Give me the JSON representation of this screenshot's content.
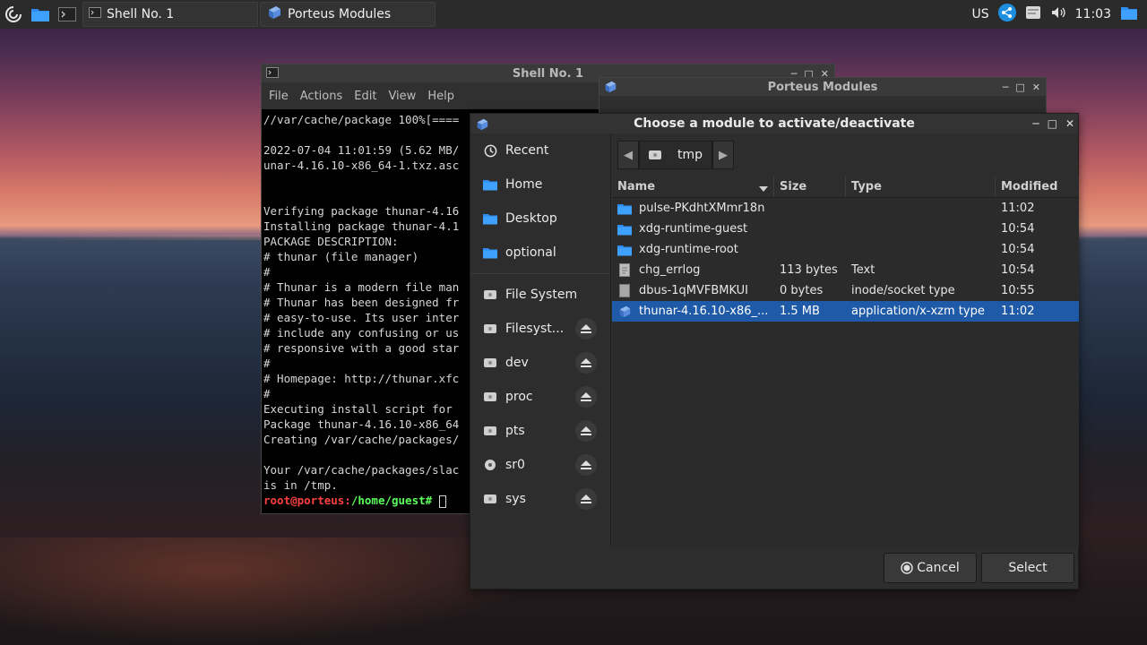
{
  "panel": {
    "tasks": [
      {
        "label": "Shell No. 1",
        "icon": "terminal-icon"
      },
      {
        "label": "Porteus Modules",
        "icon": "module-icon"
      }
    ],
    "keyboard_layout": "US",
    "clock": "11:03"
  },
  "terminal": {
    "title": "Shell No. 1",
    "menu": [
      "File",
      "Actions",
      "Edit",
      "View",
      "Help"
    ],
    "lines": [
      "//var/cache/package 100%[====",
      "",
      "2022-07-04 11:01:59 (5.62 MB/",
      "unar-4.16.10-x86_64-1.txz.asc",
      "",
      "",
      "Verifying package thunar-4.16",
      "Installing package thunar-4.1",
      "PACKAGE DESCRIPTION:",
      "# thunar (file manager)",
      "#",
      "# Thunar is a modern file man",
      "# Thunar has been designed fr",
      "# easy-to-use. Its user inter",
      "# include any confusing or us",
      "# responsive with a good star",
      "#",
      "# Homepage: http://thunar.xfc",
      "#",
      "Executing install script for ",
      "Package thunar-4.16.10-x86_64",
      "Creating /var/cache/packages/",
      "",
      "Your /var/cache/packages/slac",
      "is in /tmp."
    ],
    "prompt_user": "root@porteus:",
    "prompt_path": "/home/guest#"
  },
  "porteus_window": {
    "title": "Porteus Modules"
  },
  "dialog": {
    "title": "Choose a module to activate/deactivate",
    "sidebar": [
      {
        "label": "Recent",
        "icon": "clock-icon",
        "eject": false
      },
      {
        "label": "Home",
        "icon": "folder-icon",
        "eject": false
      },
      {
        "label": "Desktop",
        "icon": "folder-icon",
        "eject": false
      },
      {
        "label": "optional",
        "icon": "folder-icon",
        "eject": false
      },
      {
        "label": "File System",
        "icon": "drive-icon",
        "eject": false
      },
      {
        "label": "Filesyst...",
        "icon": "drive-icon",
        "eject": true
      },
      {
        "label": "dev",
        "icon": "drive-icon",
        "eject": true
      },
      {
        "label": "proc",
        "icon": "drive-icon",
        "eject": true
      },
      {
        "label": "pts",
        "icon": "drive-icon",
        "eject": true
      },
      {
        "label": "sr0",
        "icon": "disc-icon",
        "eject": true
      },
      {
        "label": "sys",
        "icon": "drive-icon",
        "eject": true
      }
    ],
    "path": {
      "current": "tmp"
    },
    "columns": {
      "name": "Name",
      "size": "Size",
      "type": "Type",
      "modified": "Modified"
    },
    "files": [
      {
        "name": "pulse-PKdhtXMmr18n",
        "size": "",
        "type": "",
        "modified": "11:02",
        "icon": "folder-icon",
        "selected": false
      },
      {
        "name": "xdg-runtime-guest",
        "size": "",
        "type": "",
        "modified": "10:54",
        "icon": "folder-icon",
        "selected": false
      },
      {
        "name": "xdg-runtime-root",
        "size": "",
        "type": "",
        "modified": "10:54",
        "icon": "folder-icon",
        "selected": false
      },
      {
        "name": "chg_errlog",
        "size": "113 bytes",
        "type": "Text",
        "modified": "10:54",
        "icon": "text-file-icon",
        "selected": false
      },
      {
        "name": "dbus-1qMVFBMKUI",
        "size": "0 bytes",
        "type": "inode/socket type",
        "modified": "10:55",
        "icon": "socket-file-icon",
        "selected": false
      },
      {
        "name": "thunar-4.16.10-x86_...",
        "size": "1.5 MB",
        "type": "application/x-xzm type",
        "modified": "11:02",
        "icon": "module-icon",
        "selected": true
      }
    ],
    "buttons": {
      "cancel": "Cancel",
      "select": "Select"
    }
  },
  "colors": {
    "panel_bg": "#2b2b2b",
    "dialog_bg": "#2d2d2d",
    "selection": "#1e5aa8",
    "folder": "#2f8cf0",
    "prompt_user": "#ff4040",
    "prompt_path": "#5cff5c"
  }
}
